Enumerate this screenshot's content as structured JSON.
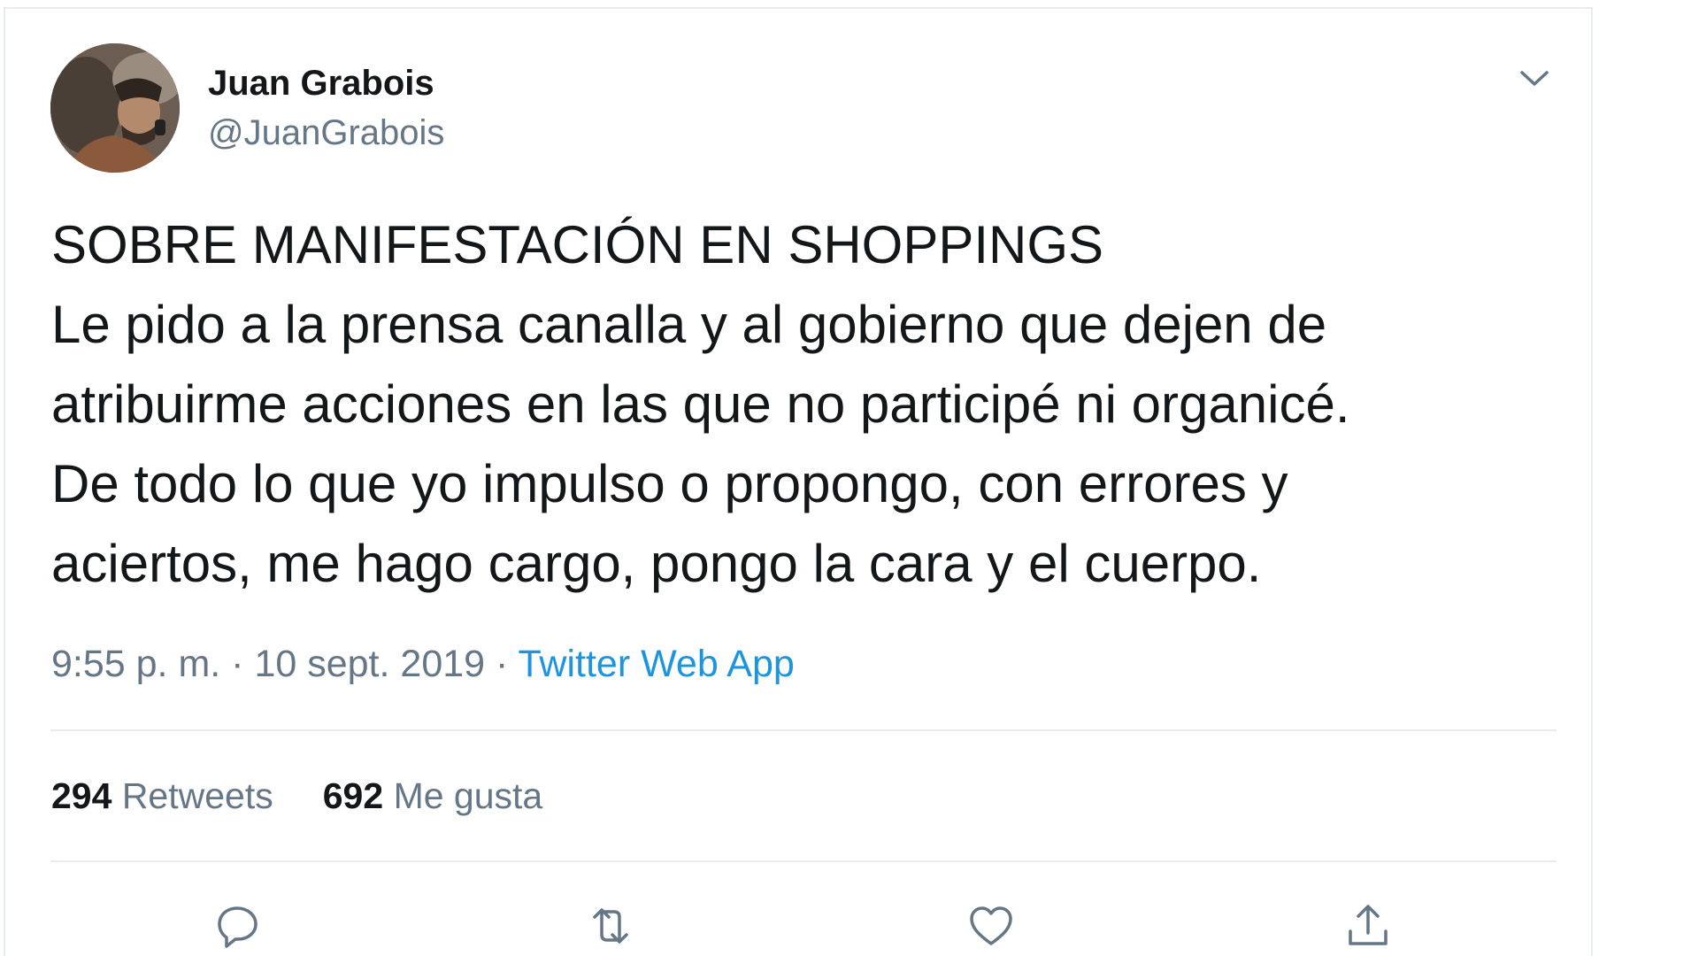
{
  "author": {
    "name": "Juan Grabois",
    "handle": "@JuanGrabois"
  },
  "tweet": {
    "lines": [
      "SOBRE MANIFESTACIÓN EN SHOPPINGS",
      "Le pido a la prensa canalla y al gobierno que dejen de",
      "atribuirme acciones en las que no participé ni organicé.",
      "De todo lo que yo impulso o propongo, con errores y",
      "aciertos, me hago cargo, pongo la cara y el cuerpo."
    ],
    "time": "9:55 p. m.",
    "separator": "·",
    "date": "10 sept. 2019",
    "source": "Twitter Web App"
  },
  "stats": {
    "retweets_count": "294",
    "retweets_label": "Retweets",
    "likes_count": "692",
    "likes_label": "Me gusta"
  },
  "icons": {
    "caret": "chevron-down-icon",
    "reply": "reply-icon",
    "retweet": "retweet-icon",
    "like": "heart-icon",
    "share": "share-icon"
  },
  "colors": {
    "text": "#14171a",
    "secondary": "#657786",
    "link": "#1b95e0",
    "border": "#e6ecf0"
  }
}
